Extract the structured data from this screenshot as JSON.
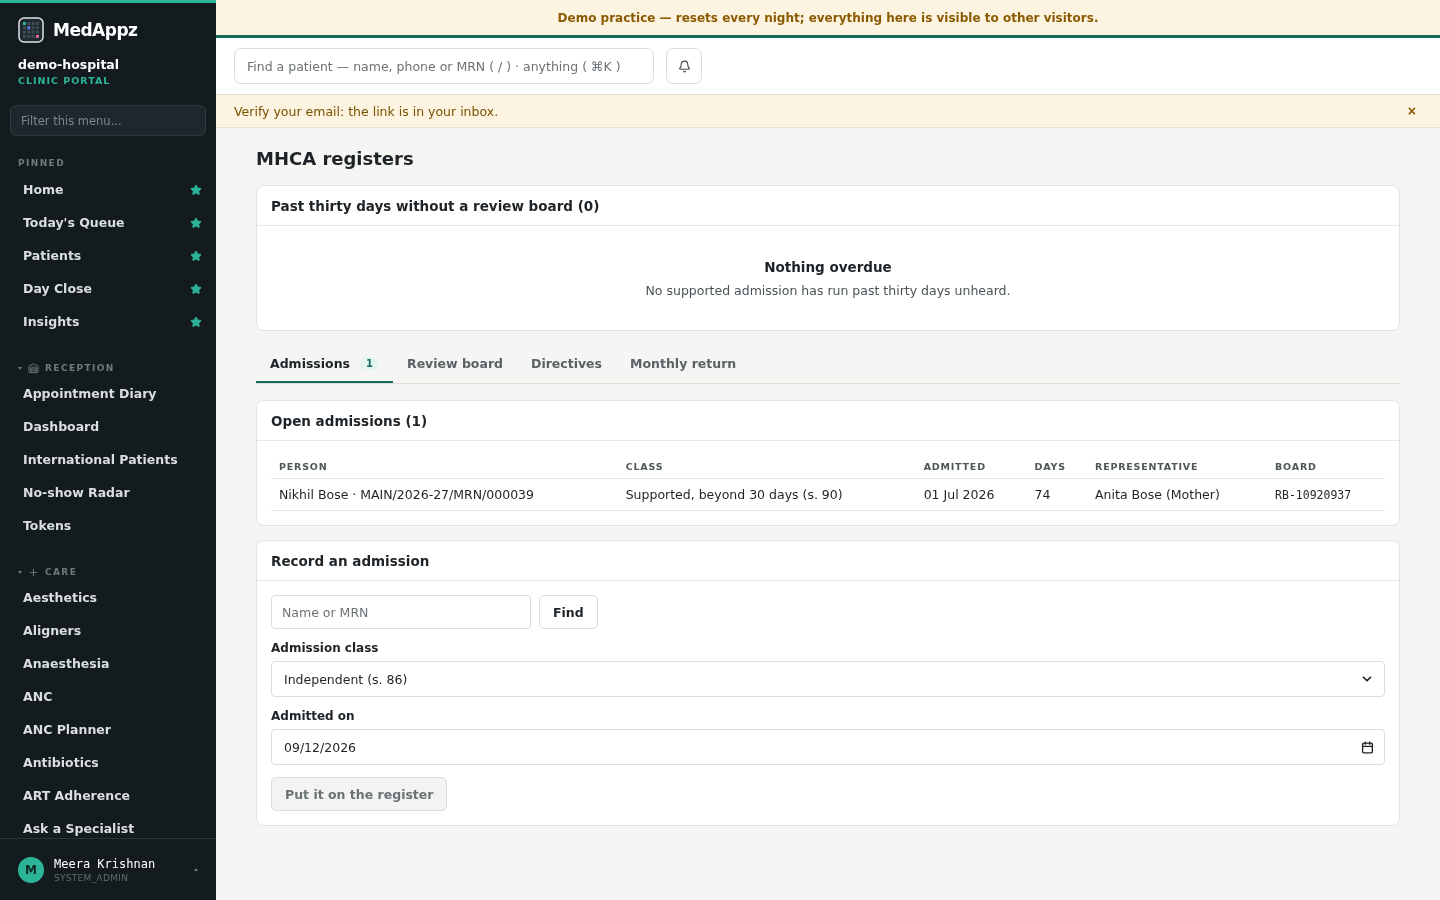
{
  "brand": {
    "name": "MedAppz",
    "org": "demo-hospital",
    "portal": "CLINIC PORTAL"
  },
  "sidebar": {
    "filter_placeholder": "Filter this menu...",
    "pinned": {
      "title": "PINNED",
      "items": [
        {
          "label": "Home",
          "starred": true
        },
        {
          "label": "Today's Queue",
          "starred": true
        },
        {
          "label": "Patients",
          "starred": true
        },
        {
          "label": "Day Close",
          "starred": true
        },
        {
          "label": "Insights",
          "starred": true
        }
      ]
    },
    "sections": [
      {
        "title": "RECEPTION",
        "kind": "building",
        "expanded": true,
        "items": [
          "Appointment Diary",
          "Dashboard",
          "International Patients",
          "No-show Radar",
          "Tokens"
        ]
      },
      {
        "title": "CARE",
        "kind": "plus",
        "expanded": true,
        "items": [
          "Aesthetics",
          "Aligners",
          "Anaesthesia",
          "ANC",
          "ANC Planner",
          "Antibiotics",
          "ART Adherence",
          "Ask a Specialist"
        ]
      }
    ],
    "user": {
      "initial": "M",
      "name": "Meera Krishnan",
      "role": "SYSTEM_ADMIN"
    }
  },
  "demo_banner": "Demo practice — resets every night; everything here is visible to other visitors.",
  "search": {
    "placeholder": "Find a patient — name, phone or MRN ( / ) · anything ( ⌘K )"
  },
  "notice": {
    "text": "Verify your email: the link is in your inbox.",
    "close": "×"
  },
  "page_title": "MHCA registers",
  "overdue": {
    "title": "Past thirty days without a review board (0)",
    "empty_title": "Nothing overdue",
    "empty_text": "No supported admission has run past thirty days unheard."
  },
  "tabs": [
    {
      "label": "Admissions",
      "count": "1",
      "selected": true
    },
    {
      "label": "Review board",
      "selected": false
    },
    {
      "label": "Directives",
      "selected": false
    },
    {
      "label": "Monthly return",
      "selected": false
    }
  ],
  "open_admissions": {
    "title": "Open admissions (1)",
    "columns": [
      "PERSON",
      "CLASS",
      "ADMITTED",
      "DAYS",
      "REPRESENTATIVE",
      "BOARD"
    ],
    "rows": [
      [
        "Nikhil Bose · MAIN/2026-27/MRN/000039",
        "Supported, beyond 30 days (s. 90)",
        "01 Jul 2026",
        "74",
        "Anita Bose (Mother)",
        "RB-10920937"
      ]
    ]
  },
  "record": {
    "title": "Record an admission",
    "patient_placeholder": "Name or MRN",
    "find": "Find",
    "class_label": "Admission class",
    "class_value": "Independent (s. 86)",
    "date_label": "Admitted on",
    "date_value": "09/12/2026",
    "submit": "Put it on the register",
    "submit_disabled": true
  }
}
